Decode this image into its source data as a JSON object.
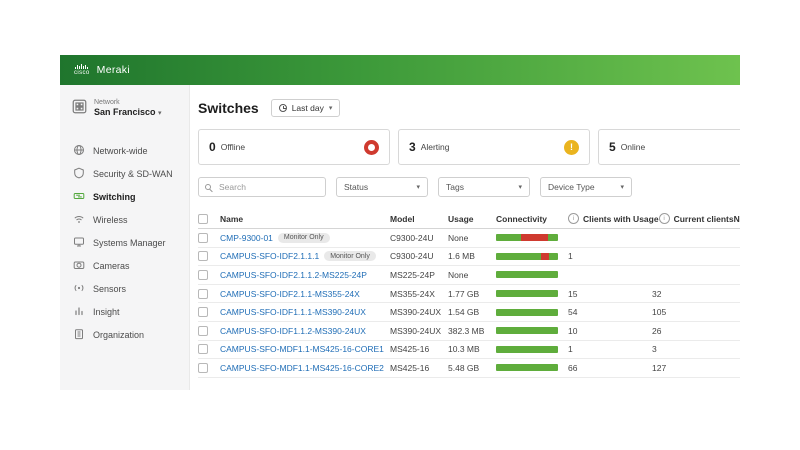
{
  "brand": {
    "cisco": "cisco",
    "product": "Meraki"
  },
  "sidebar": {
    "network_label": "Network",
    "network_name": "San Francisco",
    "items": [
      {
        "label": "Network-wide"
      },
      {
        "label": "Security & SD-WAN"
      },
      {
        "label": "Switching"
      },
      {
        "label": "Wireless"
      },
      {
        "label": "Systems Manager"
      },
      {
        "label": "Cameras"
      },
      {
        "label": "Sensors"
      },
      {
        "label": "Insight"
      },
      {
        "label": "Organization"
      }
    ]
  },
  "header": {
    "title": "Switches",
    "time_range": "Last day"
  },
  "status_cards": [
    {
      "count": "0",
      "label": "Offline"
    },
    {
      "count": "3",
      "label": "Alerting"
    },
    {
      "count": "5",
      "label": "Online"
    }
  ],
  "filters": {
    "search_placeholder": "Search",
    "status": "Status",
    "tags": "Tags",
    "device_type": "Device Type"
  },
  "table": {
    "columns": {
      "name": "Name",
      "model": "Model",
      "usage": "Usage",
      "connectivity": "Connectivity",
      "clients_with_usage": "Clients with Usage",
      "current_clients": "Current clients",
      "clipped": "N"
    },
    "rows": [
      {
        "name": "CMP-9300-01",
        "badge": "Monitor Only",
        "model": "C9300-24U",
        "usage": "None",
        "clients_with_usage": "",
        "current_clients": "",
        "connectivity": [
          {
            "color": "green",
            "pct": 40
          },
          {
            "color": "red",
            "pct": 44
          },
          {
            "color": "green",
            "pct": 16
          }
        ]
      },
      {
        "name": "CAMPUS-SFO-IDF2.1.1.1",
        "badge": "Monitor Only",
        "model": "C9300-24U",
        "usage": "1.6 MB",
        "clients_with_usage": "1",
        "current_clients": "",
        "connectivity": [
          {
            "color": "green",
            "pct": 72
          },
          {
            "color": "red",
            "pct": 13
          },
          {
            "color": "green",
            "pct": 15
          }
        ]
      },
      {
        "name": "CAMPUS-SFO-IDF2.1.1.2-MS225-24P",
        "badge": "",
        "model": "MS225-24P",
        "usage": "None",
        "clients_with_usage": "",
        "current_clients": "",
        "connectivity": [
          {
            "color": "green",
            "pct": 100
          }
        ]
      },
      {
        "name": "CAMPUS-SFO-IDF2.1.1-MS355-24X",
        "badge": "",
        "model": "MS355-24X",
        "usage": "1.77 GB",
        "clients_with_usage": "15",
        "current_clients": "32",
        "connectivity": [
          {
            "color": "green",
            "pct": 100
          }
        ]
      },
      {
        "name": "CAMPUS-SFO-IDF1.1.1-MS390-24UX",
        "badge": "",
        "model": "MS390-24UX",
        "usage": "1.54 GB",
        "clients_with_usage": "54",
        "current_clients": "105",
        "connectivity": [
          {
            "color": "green",
            "pct": 100
          }
        ]
      },
      {
        "name": "CAMPUS-SFO-IDF1.1.2-MS390-24UX",
        "badge": "",
        "model": "MS390-24UX",
        "usage": "382.3 MB",
        "clients_with_usage": "10",
        "current_clients": "26",
        "connectivity": [
          {
            "color": "green",
            "pct": 100
          }
        ]
      },
      {
        "name": "CAMPUS-SFO-MDF1.1-MS425-16-CORE1",
        "badge": "",
        "model": "MS425-16",
        "usage": "10.3 MB",
        "clients_with_usage": "1",
        "current_clients": "3",
        "connectivity": [
          {
            "color": "green",
            "pct": 100
          }
        ]
      },
      {
        "name": "CAMPUS-SFO-MDF1.1-MS425-16-CORE2",
        "badge": "",
        "model": "MS425-16",
        "usage": "5.48 GB",
        "clients_with_usage": "66",
        "current_clients": "127",
        "connectivity": [
          {
            "color": "green",
            "pct": 100
          }
        ]
      }
    ]
  },
  "colors": {
    "green": "#5fad3c",
    "red": "#cf3a2f",
    "offline": "#cf3a2f",
    "alerting": "#eab41f",
    "online": "#67b346",
    "link": "#1f6db6",
    "brand_gradient_start": "#1f752d",
    "brand_gradient_end": "#6ec24e"
  },
  "icons": {
    "chevron_down": "▾",
    "info": "i",
    "check": "✓",
    "exclamation": "!"
  }
}
